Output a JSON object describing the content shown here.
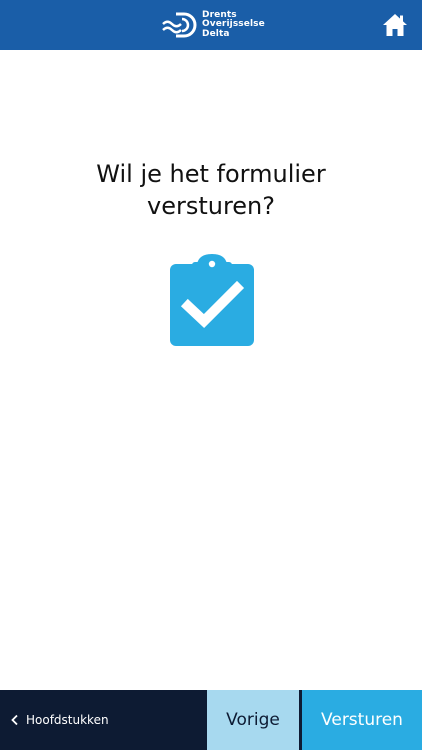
{
  "header": {
    "logo": {
      "line1": "Drents",
      "line2": "Overijsselse",
      "line3": "Delta"
    },
    "home_icon": "home-icon",
    "background_color": "#1a5ea8"
  },
  "main": {
    "question_line1": "Wil je het formulier",
    "question_line2": "versturen?",
    "icon": "clipboard-check-icon",
    "icon_color": "#2aace2"
  },
  "footer": {
    "chapters_label": "Hoofdstukken",
    "prev_label": "Vorige",
    "send_label": "Versturen",
    "colors": {
      "chapters_bg": "#0d1b33",
      "prev_bg": "#a7d9ef",
      "send_bg": "#2aace2"
    }
  }
}
